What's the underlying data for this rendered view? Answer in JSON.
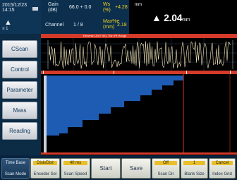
{
  "status": {
    "datetime": "2015/12/23",
    "time": "14:15",
    "nav_symbol": "▲",
    "indicator": "≡ 1"
  },
  "params": {
    "gain_label": "Gain",
    "gain_sub": "(dB)",
    "gain_value": "66.0 + 0.0",
    "channel_label": "Channel",
    "channel_value": "1 / 8",
    "p3_label": "Ws",
    "p3_sub": "(%)",
    "p3_value": "+4.28",
    "p4_label": "Max%e",
    "p4_sub": "(mm)",
    "p4_value": "2.18"
  },
  "reading": {
    "unit": "mm",
    "value": "▲ 2.04",
    "sub": "mm"
  },
  "menu": {
    "items": [
      "CScan",
      "Control",
      "Parameter",
      "Mass",
      "Reading"
    ]
  },
  "ascan": {
    "scale_text": "Reverse UNIT SEL  Thin Fft Range"
  },
  "bottom": {
    "b1_top": "Time Base",
    "b1_bottom": "Scan Mode",
    "b2_top": "Disk/Dist",
    "b2_bottom": "Encoder Sel",
    "b3_top": "40 ms",
    "b3_bottom": "Scan Speed",
    "b4": "Start",
    "b5": "Save",
    "b6_top": "Off",
    "b6_bottom": "Scan Dir",
    "b7_top": "1",
    "b7_bottom": "Blank Size",
    "b8_top": "Cancel",
    "b8_bottom": "Index Grid"
  },
  "colors": {
    "cscan_fill": "#1e5cb3",
    "cursor": "#d43a2a",
    "grid": "#2e4358",
    "waveform": "#f4e7b8"
  }
}
